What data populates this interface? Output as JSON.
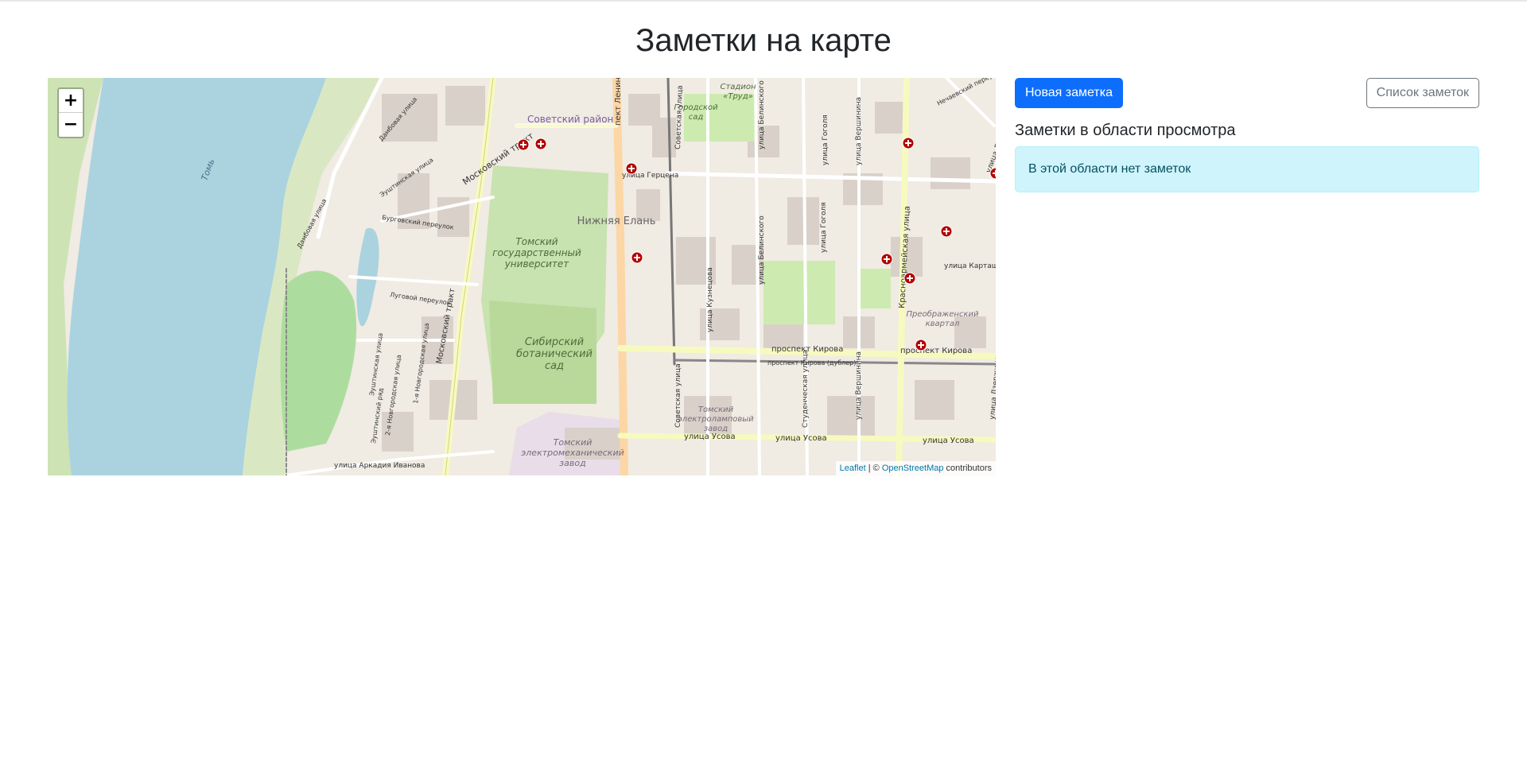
{
  "page": {
    "title": "Заметки на карте"
  },
  "toolbar": {
    "new_note_label": "Новая заметка",
    "notes_list_label": "Список заметок"
  },
  "sidebar": {
    "section_title": "Заметки в области просмотра",
    "empty_message": "В этой области нет заметок"
  },
  "map": {
    "zoom_in": "+",
    "zoom_out": "−",
    "attribution": {
      "leaflet": "Leaflet",
      "separator": " | © ",
      "osm": "OpenStreetMap",
      "contributors": " contributors"
    },
    "labels": {
      "river": "Томь",
      "district": "Советский район",
      "university": [
        "Томский",
        "государственный",
        "университет"
      ],
      "garden": [
        "Сибирский",
        "ботанический",
        "сад"
      ],
      "lower_elan": "Нижняя Елань",
      "gorodskoy_sad": [
        "Городской",
        "сад"
      ],
      "stadium": [
        "Стадион",
        "«Труд»"
      ],
      "preobr": [
        "Преображенский",
        "квартал"
      ],
      "lamp_plant": [
        "Томский",
        "электроламповый",
        "завод"
      ],
      "electromech": [
        "Томский",
        "электромеханический",
        "завод"
      ],
      "moskovsky_trakt": "Московский тракт",
      "moskovsky_trakt_2": "Московский тракт",
      "prospekt_lenina": "пект Ленина",
      "sovetskaya": "Советская улица",
      "sovetskaya_2": "Советская улица",
      "herzena": "улица Герцена",
      "kirova_1": "проспект Кирова",
      "kirova_2": "проспект Кирова",
      "kirova_dubler": "проспект Кирова (дублер)",
      "usova_1": "улица Усова",
      "usova_2": "улица Усова",
      "usova_3": "улица Усова",
      "krasnoarm": "Красноармейская улица",
      "kartashova": "улица Карташова",
      "belinskogo": "улица Белинского",
      "belinskogo_2": "улица Белинского",
      "gogolya": "улица Гоголя",
      "gogolya_2": "улица Гоголя",
      "kuznetsova": "улица Кузнецова",
      "vershinina": "улица Вершинина",
      "vershinina_2": "улица Вершинина",
      "studencheskaya": "Студенческая улица",
      "dzerzhinskogo": "улица Дзержинского",
      "dzerzhinskogo_2": "улица Дзержинского",
      "nechaevskiy": "Нечаевский переулок",
      "lugovoy": "Луговой переулок",
      "burgovskiy": "Бурговский переулок",
      "yushtinskaya": "Эуштинская улица",
      "yushtinskaya_2": "Эуштинская улица",
      "novgorodskaya": "2-я Новгородская улица",
      "novgorodskaya_2": "1-я Новгородская улица",
      "damba": "Дамбовая улица",
      "damba_2": "Дамбовая улица",
      "arkadiya": "улица Аркадия Иванова",
      "yushtinskiy_ryad": "Эуштинский ряд"
    },
    "markers_count": 10
  }
}
